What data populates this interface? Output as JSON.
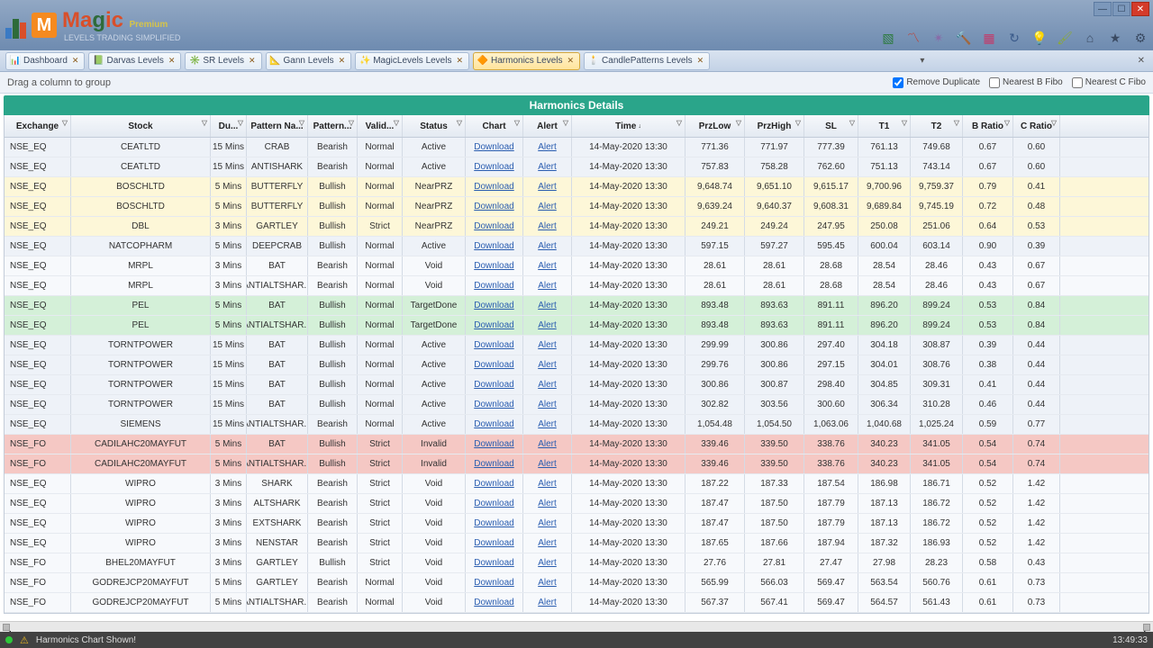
{
  "app": {
    "brand": "Magic",
    "subtitle": "LEVELS TRADING SIMPLIFIED",
    "premium": "Premium"
  },
  "tabs": [
    {
      "label": "Dashboard",
      "icon": "📊"
    },
    {
      "label": "Darvas Levels",
      "icon": "📗"
    },
    {
      "label": "SR Levels",
      "icon": "✳️"
    },
    {
      "label": "Gann Levels",
      "icon": "📐"
    },
    {
      "label": "MagicLevels Levels",
      "icon": "✨"
    },
    {
      "label": "Harmonics Levels",
      "icon": "🔶",
      "active": true
    },
    {
      "label": "CandlePatterns Levels",
      "icon": "🕯️"
    }
  ],
  "toolbar": {
    "group_hint": "Drag a column to group",
    "remove_dup": "Remove Duplicate",
    "nearest_b": "Nearest B Fibo",
    "nearest_c": "Nearest C Fibo"
  },
  "section_title": "Harmonics Details",
  "columns": [
    "Exchange",
    "Stock",
    "Du...",
    "Pattern Na...",
    "Pattern...",
    "Valid...",
    "Status",
    "Chart",
    "Alert",
    "Time",
    "PrzLow",
    "PrzHigh",
    "SL",
    "T1",
    "T2",
    "B Ratio",
    "C Ratio"
  ],
  "link_download": "Download",
  "link_alert": "Alert",
  "rows": [
    {
      "cls": "active",
      "ex": "NSE_EQ",
      "stock": "CEATLTD",
      "du": "15 Mins",
      "pat": "CRAB",
      "pt": "Bearish",
      "val": "Normal",
      "st": "Active",
      "time": "14-May-2020 13:30",
      "pl": "771.36",
      "ph": "771.97",
      "sl": "777.39",
      "t1": "761.13",
      "t2": "749.68",
      "br": "0.67",
      "cr": "0.60"
    },
    {
      "cls": "active",
      "ex": "NSE_EQ",
      "stock": "CEATLTD",
      "du": "15 Mins",
      "pat": "ANTISHARK",
      "pt": "Bearish",
      "val": "Normal",
      "st": "Active",
      "time": "14-May-2020 13:30",
      "pl": "757.83",
      "ph": "758.28",
      "sl": "762.60",
      "t1": "751.13",
      "t2": "743.14",
      "br": "0.67",
      "cr": "0.60"
    },
    {
      "cls": "near",
      "ex": "NSE_EQ",
      "stock": "BOSCHLTD",
      "du": "5 Mins",
      "pat": "BUTTERFLY",
      "pt": "Bullish",
      "val": "Normal",
      "st": "NearPRZ",
      "time": "14-May-2020 13:30",
      "pl": "9,648.74",
      "ph": "9,651.10",
      "sl": "9,615.17",
      "t1": "9,700.96",
      "t2": "9,759.37",
      "br": "0.79",
      "cr": "0.41"
    },
    {
      "cls": "near",
      "ex": "NSE_EQ",
      "stock": "BOSCHLTD",
      "du": "5 Mins",
      "pat": "BUTTERFLY",
      "pt": "Bullish",
      "val": "Normal",
      "st": "NearPRZ",
      "time": "14-May-2020 13:30",
      "pl": "9,639.24",
      "ph": "9,640.37",
      "sl": "9,608.31",
      "t1": "9,689.84",
      "t2": "9,745.19",
      "br": "0.72",
      "cr": "0.48"
    },
    {
      "cls": "near",
      "ex": "NSE_EQ",
      "stock": "DBL",
      "du": "3 Mins",
      "pat": "GARTLEY",
      "pt": "Bullish",
      "val": "Strict",
      "st": "NearPRZ",
      "time": "14-May-2020 13:30",
      "pl": "249.21",
      "ph": "249.24",
      "sl": "247.95",
      "t1": "250.08",
      "t2": "251.06",
      "br": "0.64",
      "cr": "0.53"
    },
    {
      "cls": "active",
      "ex": "NSE_EQ",
      "stock": "NATCOPHARM",
      "du": "5 Mins",
      "pat": "DEEPCRAB",
      "pt": "Bullish",
      "val": "Normal",
      "st": "Active",
      "time": "14-May-2020 13:30",
      "pl": "597.15",
      "ph": "597.27",
      "sl": "595.45",
      "t1": "600.04",
      "t2": "603.14",
      "br": "0.90",
      "cr": "0.39"
    },
    {
      "cls": "void",
      "ex": "NSE_EQ",
      "stock": "MRPL",
      "du": "3 Mins",
      "pat": "BAT",
      "pt": "Bearish",
      "val": "Normal",
      "st": "Void",
      "time": "14-May-2020 13:30",
      "pl": "28.61",
      "ph": "28.61",
      "sl": "28.68",
      "t1": "28.54",
      "t2": "28.46",
      "br": "0.43",
      "cr": "0.67"
    },
    {
      "cls": "void",
      "ex": "NSE_EQ",
      "stock": "MRPL",
      "du": "3 Mins",
      "pat": "ANTIALTSHAR...",
      "pt": "Bearish",
      "val": "Normal",
      "st": "Void",
      "time": "14-May-2020 13:30",
      "pl": "28.61",
      "ph": "28.61",
      "sl": "28.68",
      "t1": "28.54",
      "t2": "28.46",
      "br": "0.43",
      "cr": "0.67"
    },
    {
      "cls": "done",
      "ex": "NSE_EQ",
      "stock": "PEL",
      "du": "5 Mins",
      "pat": "BAT",
      "pt": "Bullish",
      "val": "Normal",
      "st": "TargetDone",
      "time": "14-May-2020 13:30",
      "pl": "893.48",
      "ph": "893.63",
      "sl": "891.11",
      "t1": "896.20",
      "t2": "899.24",
      "br": "0.53",
      "cr": "0.84"
    },
    {
      "cls": "done",
      "ex": "NSE_EQ",
      "stock": "PEL",
      "du": "5 Mins",
      "pat": "ANTIALTSHAR...",
      "pt": "Bullish",
      "val": "Normal",
      "st": "TargetDone",
      "time": "14-May-2020 13:30",
      "pl": "893.48",
      "ph": "893.63",
      "sl": "891.11",
      "t1": "896.20",
      "t2": "899.24",
      "br": "0.53",
      "cr": "0.84"
    },
    {
      "cls": "active",
      "ex": "NSE_EQ",
      "stock": "TORNTPOWER",
      "du": "15 Mins",
      "pat": "BAT",
      "pt": "Bullish",
      "val": "Normal",
      "st": "Active",
      "time": "14-May-2020 13:30",
      "pl": "299.99",
      "ph": "300.86",
      "sl": "297.40",
      "t1": "304.18",
      "t2": "308.87",
      "br": "0.39",
      "cr": "0.44"
    },
    {
      "cls": "active",
      "ex": "NSE_EQ",
      "stock": "TORNTPOWER",
      "du": "15 Mins",
      "pat": "BAT",
      "pt": "Bullish",
      "val": "Normal",
      "st": "Active",
      "time": "14-May-2020 13:30",
      "pl": "299.76",
      "ph": "300.86",
      "sl": "297.15",
      "t1": "304.01",
      "t2": "308.76",
      "br": "0.38",
      "cr": "0.44"
    },
    {
      "cls": "active",
      "ex": "NSE_EQ",
      "stock": "TORNTPOWER",
      "du": "15 Mins",
      "pat": "BAT",
      "pt": "Bullish",
      "val": "Normal",
      "st": "Active",
      "time": "14-May-2020 13:30",
      "pl": "300.86",
      "ph": "300.87",
      "sl": "298.40",
      "t1": "304.85",
      "t2": "309.31",
      "br": "0.41",
      "cr": "0.44"
    },
    {
      "cls": "active",
      "ex": "NSE_EQ",
      "stock": "TORNTPOWER",
      "du": "15 Mins",
      "pat": "BAT",
      "pt": "Bullish",
      "val": "Normal",
      "st": "Active",
      "time": "14-May-2020 13:30",
      "pl": "302.82",
      "ph": "303.56",
      "sl": "300.60",
      "t1": "306.34",
      "t2": "310.28",
      "br": "0.46",
      "cr": "0.44"
    },
    {
      "cls": "active",
      "ex": "NSE_EQ",
      "stock": "SIEMENS",
      "du": "15 Mins",
      "pat": "ANTIALTSHAR...",
      "pt": "Bearish",
      "val": "Normal",
      "st": "Active",
      "time": "14-May-2020 13:30",
      "pl": "1,054.48",
      "ph": "1,054.50",
      "sl": "1,063.06",
      "t1": "1,040.68",
      "t2": "1,025.24",
      "br": "0.59",
      "cr": "0.77"
    },
    {
      "cls": "invalid",
      "ex": "NSE_FO",
      "stock": "CADILAHC20MAYFUT",
      "du": "5 Mins",
      "pat": "BAT",
      "pt": "Bullish",
      "val": "Strict",
      "st": "Invalid",
      "time": "14-May-2020 13:30",
      "pl": "339.46",
      "ph": "339.50",
      "sl": "338.76",
      "t1": "340.23",
      "t2": "341.05",
      "br": "0.54",
      "cr": "0.74"
    },
    {
      "cls": "invalid",
      "ex": "NSE_FO",
      "stock": "CADILAHC20MAYFUT",
      "du": "5 Mins",
      "pat": "ANTIALTSHAR...",
      "pt": "Bullish",
      "val": "Strict",
      "st": "Invalid",
      "time": "14-May-2020 13:30",
      "pl": "339.46",
      "ph": "339.50",
      "sl": "338.76",
      "t1": "340.23",
      "t2": "341.05",
      "br": "0.54",
      "cr": "0.74"
    },
    {
      "cls": "void",
      "ex": "NSE_EQ",
      "stock": "WIPRO",
      "du": "3 Mins",
      "pat": "SHARK",
      "pt": "Bearish",
      "val": "Strict",
      "st": "Void",
      "time": "14-May-2020 13:30",
      "pl": "187.22",
      "ph": "187.33",
      "sl": "187.54",
      "t1": "186.98",
      "t2": "186.71",
      "br": "0.52",
      "cr": "1.42"
    },
    {
      "cls": "void",
      "ex": "NSE_EQ",
      "stock": "WIPRO",
      "du": "3 Mins",
      "pat": "ALTSHARK",
      "pt": "Bearish",
      "val": "Strict",
      "st": "Void",
      "time": "14-May-2020 13:30",
      "pl": "187.47",
      "ph": "187.50",
      "sl": "187.79",
      "t1": "187.13",
      "t2": "186.72",
      "br": "0.52",
      "cr": "1.42"
    },
    {
      "cls": "void",
      "ex": "NSE_EQ",
      "stock": "WIPRO",
      "du": "3 Mins",
      "pat": "EXTSHARK",
      "pt": "Bearish",
      "val": "Strict",
      "st": "Void",
      "time": "14-May-2020 13:30",
      "pl": "187.47",
      "ph": "187.50",
      "sl": "187.79",
      "t1": "187.13",
      "t2": "186.72",
      "br": "0.52",
      "cr": "1.42"
    },
    {
      "cls": "void",
      "ex": "NSE_EQ",
      "stock": "WIPRO",
      "du": "3 Mins",
      "pat": "NENSTAR",
      "pt": "Bearish",
      "val": "Strict",
      "st": "Void",
      "time": "14-May-2020 13:30",
      "pl": "187.65",
      "ph": "187.66",
      "sl": "187.94",
      "t1": "187.32",
      "t2": "186.93",
      "br": "0.52",
      "cr": "1.42"
    },
    {
      "cls": "void",
      "ex": "NSE_FO",
      "stock": "BHEL20MAYFUT",
      "du": "3 Mins",
      "pat": "GARTLEY",
      "pt": "Bullish",
      "val": "Strict",
      "st": "Void",
      "time": "14-May-2020 13:30",
      "pl": "27.76",
      "ph": "27.81",
      "sl": "27.47",
      "t1": "27.98",
      "t2": "28.23",
      "br": "0.58",
      "cr": "0.43"
    },
    {
      "cls": "void",
      "ex": "NSE_FO",
      "stock": "GODREJCP20MAYFUT",
      "du": "5 Mins",
      "pat": "GARTLEY",
      "pt": "Bearish",
      "val": "Normal",
      "st": "Void",
      "time": "14-May-2020 13:30",
      "pl": "565.99",
      "ph": "566.03",
      "sl": "569.47",
      "t1": "563.54",
      "t2": "560.76",
      "br": "0.61",
      "cr": "0.73"
    },
    {
      "cls": "void",
      "ex": "NSE_FO",
      "stock": "GODREJCP20MAYFUT",
      "du": "5 Mins",
      "pat": "ANTIALTSHAR...",
      "pt": "Bearish",
      "val": "Normal",
      "st": "Void",
      "time": "14-May-2020 13:30",
      "pl": "567.37",
      "ph": "567.41",
      "sl": "569.47",
      "t1": "564.57",
      "t2": "561.43",
      "br": "0.61",
      "cr": "0.73"
    }
  ],
  "status": {
    "msg": "Harmonics Chart Shown!",
    "time": "13:49:33"
  }
}
